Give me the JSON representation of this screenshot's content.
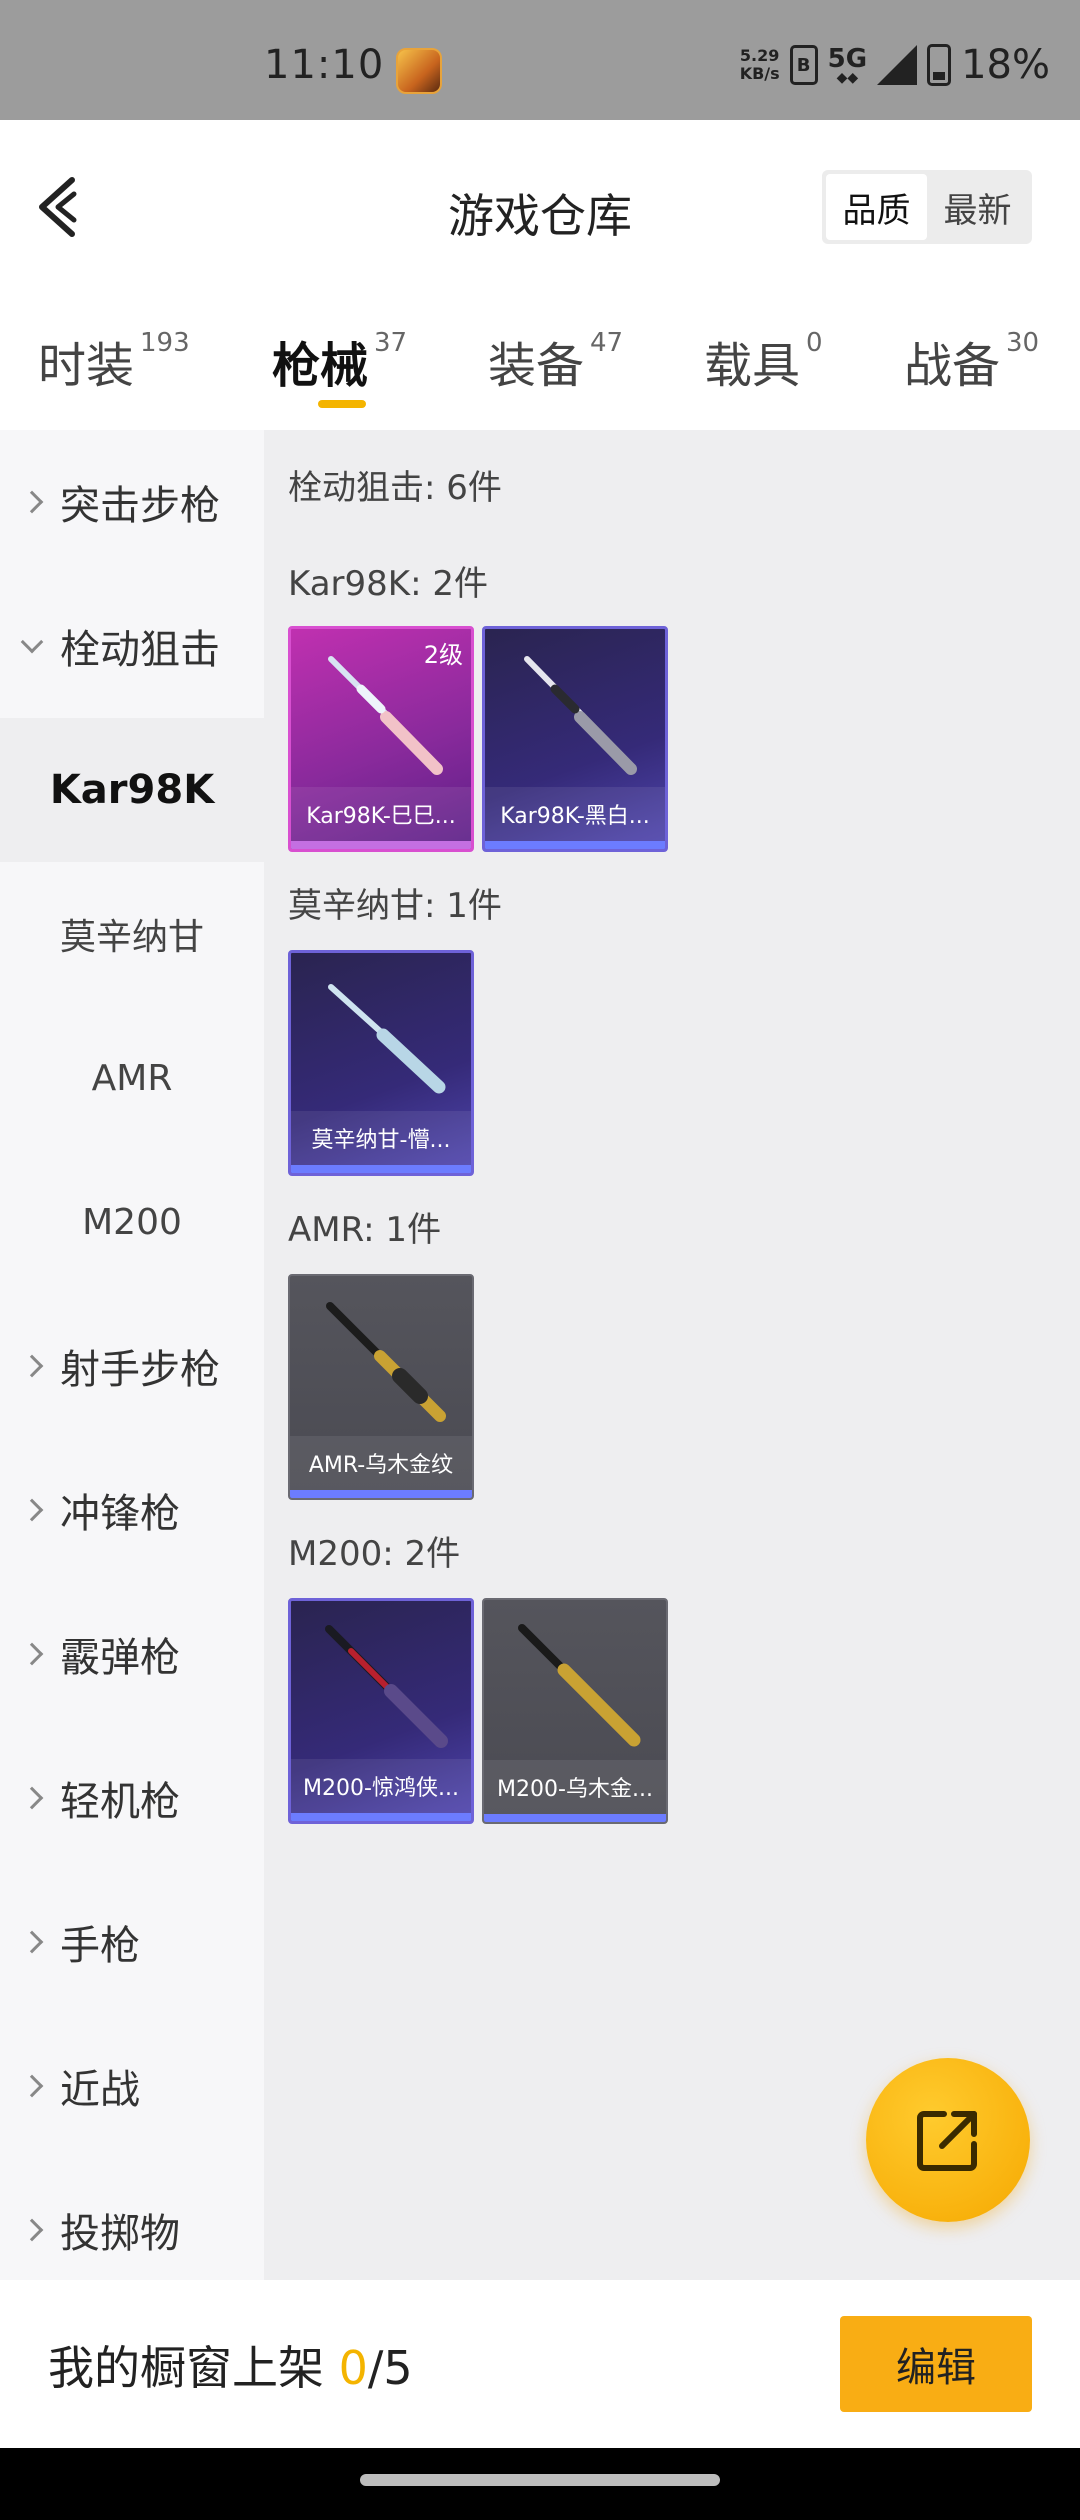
{
  "status_bar": {
    "time": "11:10",
    "speed_value": "5.29",
    "speed_unit": "KB/s",
    "sim_label": "B",
    "network": "5G",
    "battery": "18%"
  },
  "header": {
    "title": "游戏仓库",
    "sort_options": [
      "品质",
      "最新"
    ],
    "active_sort": "品质"
  },
  "tabs": [
    {
      "label": "时装",
      "count": "193"
    },
    {
      "label": "枪械",
      "count": "37"
    },
    {
      "label": "装备",
      "count": "47"
    },
    {
      "label": "载具",
      "count": "0"
    },
    {
      "label": "战备",
      "count": "30"
    }
  ],
  "active_tab": "枪械",
  "sidebar": {
    "categories": [
      {
        "label": "突击步枪",
        "expanded": false
      },
      {
        "label": "栓动狙击",
        "expanded": true
      },
      {
        "label": "射手步枪",
        "expanded": false
      },
      {
        "label": "冲锋枪",
        "expanded": false
      },
      {
        "label": "霰弹枪",
        "expanded": false
      },
      {
        "label": "轻机枪",
        "expanded": false
      },
      {
        "label": "手枪",
        "expanded": false
      },
      {
        "label": "近战",
        "expanded": false
      },
      {
        "label": "投掷物",
        "expanded": false
      }
    ],
    "subitems": [
      "Kar98K",
      "莫辛纳甘",
      "AMR",
      "M200"
    ],
    "active_subitem": "Kar98K"
  },
  "content": {
    "total_title": "栓动狙击: 6件",
    "sections": [
      {
        "title": "Kar98K: 2件",
        "items": [
          {
            "name": "Kar98K-巳巳...",
            "rarity": "pink",
            "level": "2级"
          },
          {
            "name": "Kar98K-黑白...",
            "rarity": "purple",
            "level": ""
          }
        ]
      },
      {
        "title": "莫辛纳甘: 1件",
        "items": [
          {
            "name": "莫辛纳甘-懵...",
            "rarity": "purple",
            "level": ""
          }
        ]
      },
      {
        "title": "AMR: 1件",
        "items": [
          {
            "name": "AMR-乌木金纹",
            "rarity": "gray",
            "level": ""
          }
        ]
      },
      {
        "title": "M200: 2件",
        "items": [
          {
            "name": "M200-惊鸿侠...",
            "rarity": "purple",
            "level": ""
          },
          {
            "name": "M200-乌木金...",
            "rarity": "gray",
            "level": ""
          }
        ]
      }
    ]
  },
  "bottom_bar": {
    "label": "我的橱窗上架 ",
    "current": "0",
    "separator": "/",
    "max": "5",
    "edit_label": "编辑"
  },
  "colors": {
    "accent": "#f4b400",
    "edit_button": "#f9ad14",
    "rarity_pink": "#c030b0",
    "rarity_purple": "#352a78",
    "rarity_gray": "#4a4a52"
  },
  "icons": {
    "back": "back-arrow-icon",
    "share": "share-external-icon",
    "app": "game-app-icon"
  }
}
